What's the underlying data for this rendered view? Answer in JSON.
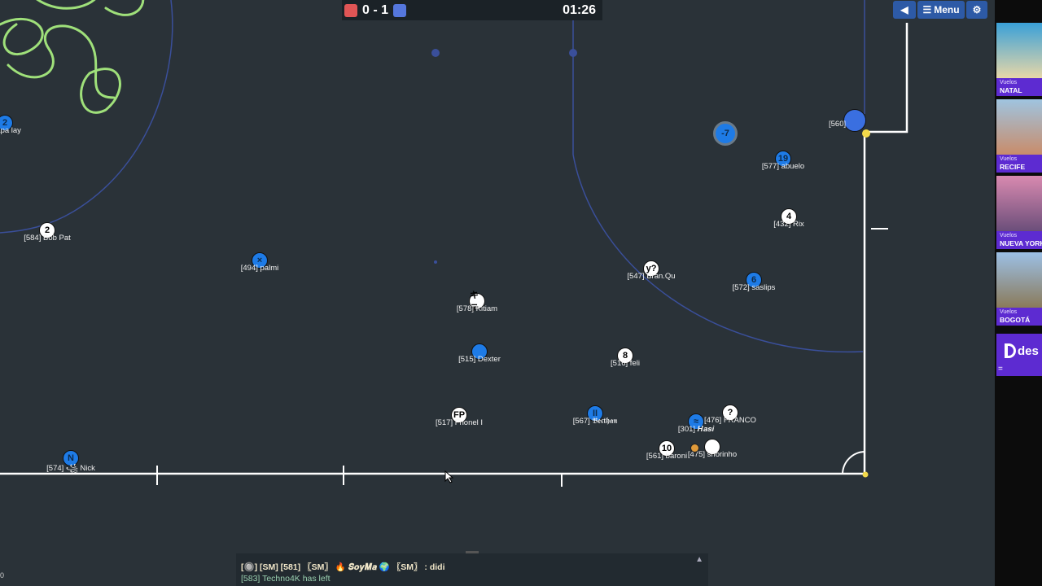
{
  "scoreboard": {
    "red_color": "#e05555",
    "blue_color": "#5577dd",
    "score": "0 - 1",
    "timer": "01:26"
  },
  "top_buttons": {
    "sound_icon": "speaker-back-icon",
    "menu_label": "Menu",
    "settings_icon": "gear-icon"
  },
  "players": [
    {
      "avatar": "2",
      "name": "papa lay",
      "team": "blue"
    },
    {
      "avatar": "2",
      "name": "[584] Bob Pat",
      "team": "red"
    },
    {
      "avatar": "×",
      "name": "[494] palmi",
      "team": "blue"
    },
    {
      "avatar": "キテ",
      "name": "[578] Kitiam",
      "team": "red"
    },
    {
      "avatar": "",
      "name": "[515] Dexter",
      "team": "blue"
    },
    {
      "avatar": "FP",
      "name": "[517] Frionel I",
      "team": "red"
    },
    {
      "avatar": "N",
      "name": "[574] ꧁ Nick",
      "team": "blue"
    },
    {
      "avatar": "8",
      "name": "[516] feli",
      "team": "red"
    },
    {
      "avatar": "II",
      "name": "[567] 𝕭𝖊𝖈𝖙𝖍𝖆𝖓",
      "team": "blue"
    },
    {
      "avatar": "≈",
      "name": "[301] 𝑯𝒂𝒔𝒊",
      "team": "blue"
    },
    {
      "avatar": "?",
      "name": "[476] FRANCO",
      "team": "red"
    },
    {
      "avatar": "10",
      "name": "[561] baroni",
      "team": "red"
    },
    {
      "avatar": "",
      "name": "[475] shorinho",
      "team": "red"
    },
    {
      "avatar": "y?",
      "name": "[547] Bran.Qu",
      "team": "red"
    },
    {
      "avatar": "6",
      "name": "[572] saslips",
      "team": "blue"
    },
    {
      "avatar": "4",
      "name": "[432] Rix",
      "team": "red"
    },
    {
      "avatar": "19",
      "name": "[577] abuelo",
      "team": "blue"
    },
    {
      "avatar": "-7",
      "name": "",
      "team": "blue"
    },
    {
      "avatar": "",
      "name": "[560]",
      "team": "blue"
    }
  ],
  "ads": [
    {
      "tag": "Vuelos",
      "city": "NATAL",
      "colors": [
        "#3aa0d8",
        "#e7d7a8"
      ]
    },
    {
      "tag": "Vuelos",
      "city": "RECIFE",
      "colors": [
        "#9fc4e0",
        "#c98c6a"
      ]
    },
    {
      "tag": "Vuelos",
      "city": "NUEVA YORK",
      "colors": [
        "#d98ab0",
        "#6b4e7a"
      ]
    },
    {
      "tag": "Vuelos",
      "city": "BOGOTÁ",
      "colors": [
        "#9cc0e6",
        "#8a7a5a"
      ]
    }
  ],
  "brand": {
    "text": "des",
    "eq": "="
  },
  "chat": {
    "line1": "[🔘] [SM] [581] 〖SM〗 🔥 𝑺𝒐𝒚𝑴𝒂 🌍 〖SM〗 : didi",
    "line2": "[583] Techno4K has left"
  },
  "corner_mark": "0"
}
